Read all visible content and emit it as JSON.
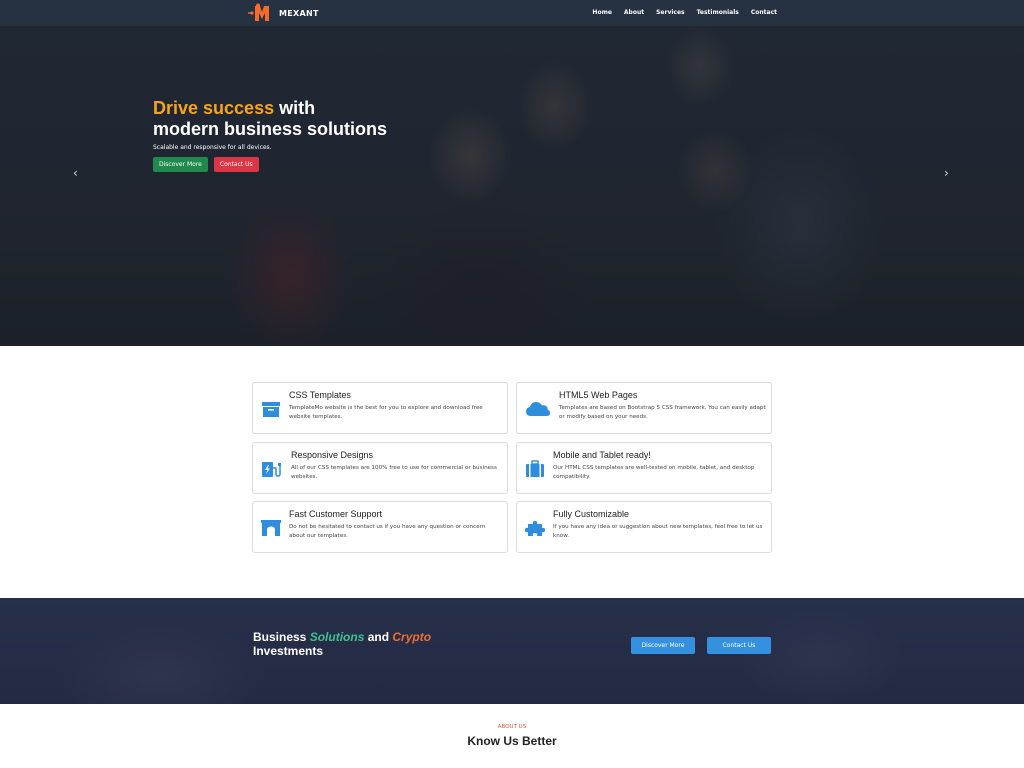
{
  "navbar": {
    "brand": "MEXANT",
    "links": [
      "Home",
      "About",
      "Services",
      "Testimonials",
      "Contact"
    ]
  },
  "hero": {
    "title_accent": "Drive success",
    "title_rest_1": " with",
    "title_line_2": "modern business solutions",
    "subtitle": "Scalable and responsive for all devices.",
    "primary_button": "Discover More",
    "secondary_button": "Contact Us",
    "prev_arrow": "‹",
    "next_arrow": "›"
  },
  "features": [
    {
      "title": "CSS Templates",
      "desc": "TemplateMo website is the best for you to explore and download free website templates.",
      "icon": "archive-box-icon"
    },
    {
      "title": "HTML5 Web Pages",
      "desc": "Templates are based on Bootstrap 5 CSS framework. You can easily adapt or modify based on your needs.",
      "icon": "cloud-icon"
    },
    {
      "title": "Responsive Designs",
      "desc": "All of our CSS templates are 100% free to use for commercial or business websites.",
      "icon": "charging-station-icon"
    },
    {
      "title": "Mobile and Tablet ready!",
      "desc": "Our HTML CSS templates are well-tested on mobile, tablet, and desktop compatibility.",
      "icon": "suitcase-icon"
    },
    {
      "title": "Fast Customer Support",
      "desc": "Do not be hesitated to contact us if you have any question or concern about our templates.",
      "icon": "archway-icon"
    },
    {
      "title": "Fully Customizable",
      "desc": "If you have any idea or suggestion about new templates, feel free to let us know.",
      "icon": "puzzle-piece-icon"
    }
  ],
  "banner": {
    "part1": "Business ",
    "solutions": "Solutions",
    "part2": " and ",
    "crypto": "Crypto",
    "part3": "Investments",
    "btn_discover": "Discover More",
    "btn_contact": "Contact Us"
  },
  "about": {
    "label": "ABOUT US",
    "title": "Know Us Better"
  },
  "colors": {
    "nav_bg": "#263142",
    "accent_orange": "#f7a41d",
    "btn_green": "#1f8a4c",
    "btn_red": "#dc3545",
    "icon_blue": "#2f8ddd",
    "banner_btn": "#3591e0",
    "about_label": "#e2572a"
  }
}
